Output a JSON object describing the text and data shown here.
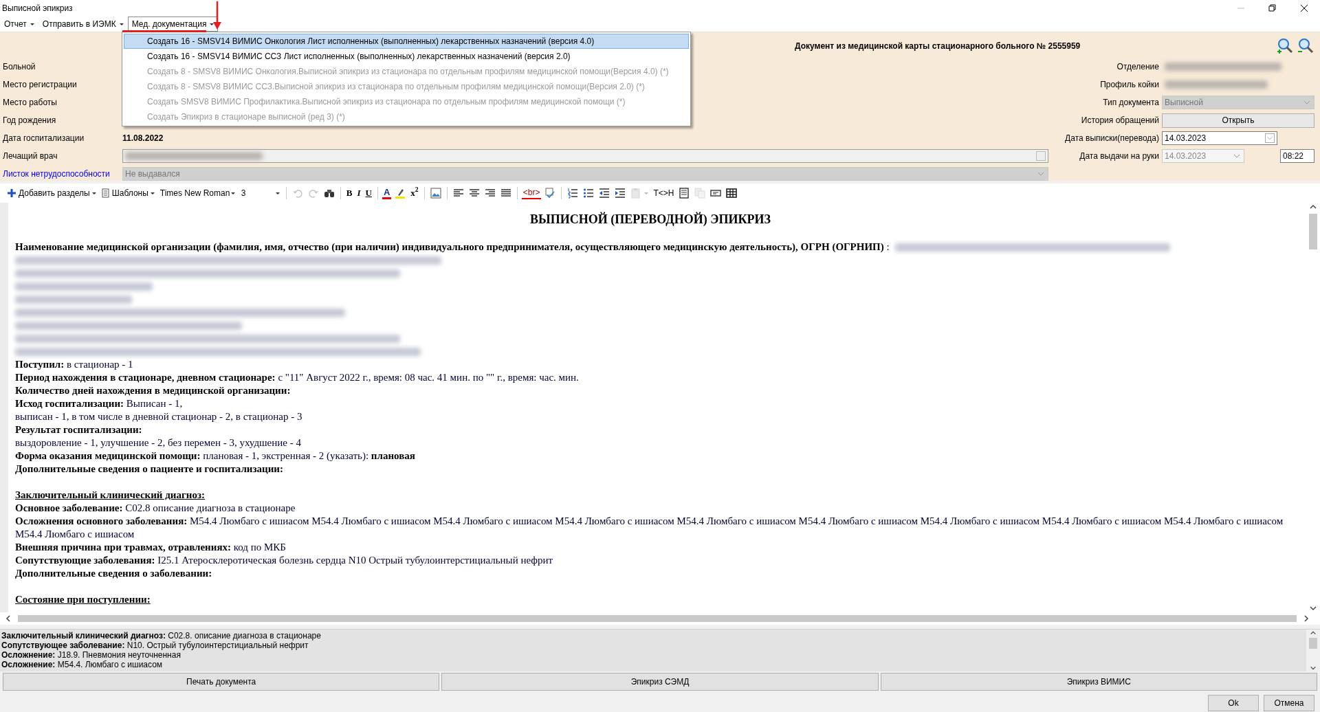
{
  "window": {
    "title": "Выписной эпикриз"
  },
  "menu": [
    {
      "label": "Отчет",
      "open": false
    },
    {
      "label": "Отправить в ИЭМК",
      "open": false
    },
    {
      "label": "Мед. документация",
      "open": true
    }
  ],
  "dropdown": [
    {
      "label": "Создать 16 - SMSV14 ВИМИС Онкология Лист исполненных (выполненных) лекарственных назначений (версия 4.0)",
      "selected": true,
      "disabled": false
    },
    {
      "label": "Создать 16 - SMSV14 ВИМИС ССЗ Лист исполненных (выполненных) лекарственных назначений (версия 2.0)",
      "selected": false,
      "disabled": false
    },
    {
      "label": "Создать 8 - SMSV8 ВИМИС Онкология.Выписной эпикриз из стационара по отдельным профилям медицинской помощи(Версия 4.0) (*)",
      "selected": false,
      "disabled": true
    },
    {
      "label": "Создать 8 - SMSV8 ВИМИС ССЗ.Выписной эпикриз из стационара по отдельным профилям медицинской помощи(Версия 2.0) (*)",
      "selected": false,
      "disabled": true
    },
    {
      "label": "Создать SMSV8 ВИМИС Профилактика.Выписной эпикриз из стационара по отдельным профилям медицинской помощи (*)",
      "selected": false,
      "disabled": true
    },
    {
      "label": "Создать Эпикриз в стационаре выписной (ред 3) (*)",
      "selected": false,
      "disabled": true
    }
  ],
  "header": {
    "title": "Документ из медицинской карты стационарного больного №  2555959",
    "left_fields": [
      {
        "label": "Больной",
        "kind": "empty",
        "link": false
      },
      {
        "label": "Место регистрации",
        "kind": "empty",
        "link": false
      },
      {
        "label": "Место работы",
        "kind": "empty",
        "link": false
      },
      {
        "label": "Год рождения",
        "kind": "empty",
        "link": false
      },
      {
        "label": "Дата госпитализации",
        "kind": "bold",
        "value": "11.08.2022",
        "link": false
      },
      {
        "label": "Лечащий врач",
        "kind": "lookup_blur",
        "link": false
      },
      {
        "label": "Листок нетрудоспособности",
        "kind": "select",
        "value": "Не выдавался",
        "disabled": true,
        "link": true
      }
    ],
    "right_fields": [
      {
        "label": "Отделение",
        "kind": "blur"
      },
      {
        "label": "Профиль койки",
        "kind": "blur"
      },
      {
        "label": "Тип документа",
        "kind": "select",
        "value": "Выписной",
        "disabled": true
      },
      {
        "label": "История обращений",
        "kind": "button",
        "value": "Открыть"
      },
      {
        "label": "Дата выписки(перевода)",
        "kind": "date",
        "value": "14.03.2023",
        "disabled": false
      },
      {
        "label": "Дата выдачи на руки",
        "kind": "date_time",
        "value": "14.03.2023",
        "time": "08:22",
        "disabled": true
      }
    ]
  },
  "toolbar": {
    "add_sections": "Добавить разделы",
    "templates": "Шаблоны",
    "font": "Times New Roman",
    "size": "3",
    "groups": [
      [
        {
          "kind": "undo",
          "disabled": true
        },
        {
          "kind": "redo",
          "disabled": true
        },
        {
          "kind": "find",
          "disabled": false
        }
      ],
      [
        {
          "kind": "bold",
          "label": "B",
          "disabled": false
        },
        {
          "kind": "italic",
          "label": "I",
          "disabled": false
        },
        {
          "kind": "underline",
          "label": "U",
          "disabled": false
        }
      ],
      [
        {
          "kind": "fontcolor",
          "label": "A",
          "disabled": false
        },
        {
          "kind": "highlight",
          "disabled": false
        },
        {
          "kind": "superscript",
          "label": "x$^{2}$",
          "disabled": false
        }
      ],
      [
        {
          "kind": "image",
          "disabled": false
        }
      ],
      [
        {
          "kind": "align-left",
          "disabled": false
        },
        {
          "kind": "align-center",
          "disabled": false
        },
        {
          "kind": "align-right",
          "disabled": false
        },
        {
          "kind": "justify",
          "disabled": false
        }
      ],
      [
        {
          "kind": "striptags",
          "label": "<br>",
          "disabled": false
        },
        {
          "kind": "spellcheck",
          "disabled": false
        }
      ],
      [
        {
          "kind": "ordered-list",
          "disabled": false
        },
        {
          "kind": "bullet-list",
          "disabled": false
        },
        {
          "kind": "outdent",
          "disabled": false
        },
        {
          "kind": "indent",
          "disabled": false
        },
        {
          "kind": "paste",
          "disabled": true
        },
        {
          "kind": "text",
          "label": "T<>H",
          "disabled": false
        },
        {
          "kind": "document",
          "disabled": false
        },
        {
          "kind": "copy",
          "disabled": true
        },
        {
          "kind": "field",
          "disabled": false
        },
        {
          "kind": "table",
          "disabled": false
        }
      ]
    ]
  },
  "document": [
    {
      "kind": "title",
      "text": "ВЫПИСНОЙ (ПЕРЕВОДНОЙ) ЭПИКРИЗ"
    },
    {
      "kind": "para_blur",
      "text": "**Наименование медицинской организации (фамилия, имя, отчество (при наличии) индивидуального предпринимателя, осуществляющего медицинскую деятельность), ОГРН (ОГРНИП)** :"
    },
    {
      "kind": "blur"
    },
    {
      "kind": "blur"
    },
    {
      "kind": "blur"
    },
    {
      "kind": "blur"
    },
    {
      "kind": "blur"
    },
    {
      "kind": "blur"
    },
    {
      "kind": "blur"
    },
    {
      "kind": "blur"
    },
    {
      "kind": "para",
      "text": "**Поступил:** в стационар - 1"
    },
    {
      "kind": "para",
      "text": "**Период нахождения в стационаре, дневном стационаре:** с \"11\" Август 2022 г., время: 08 час. 41 мин. по \"\" г., время: час. мин."
    },
    {
      "kind": "para",
      "text": "**Количество дней нахождения в медицинской организации:**"
    },
    {
      "kind": "para",
      "text": "**Исход госпитализации:** Выписан - 1,"
    },
    {
      "kind": "para",
      "text": "выписан - 1, в том числе в дневной стационар - 2, в стационар - 3"
    },
    {
      "kind": "para",
      "text": "**Результат госпитализации:**"
    },
    {
      "kind": "para",
      "text": "выздоровление - 1, улучшение - 2, без перемен - 3, ухудшение - 4"
    },
    {
      "kind": "para",
      "text": "**Форма оказания медицинской помощи:** плановая - 1, экстренная - 2 (указать): **плановая**"
    },
    {
      "kind": "para",
      "text": "**Дополнительные сведения о пациенте и госпитализации:**"
    },
    {
      "kind": "blank"
    },
    {
      "kind": "section",
      "text": "Заключительный клинический диагноз:"
    },
    {
      "kind": "para",
      "text": "**Основное заболевание:** C02.8 описание диагноза в стационаре"
    },
    {
      "kind": "para",
      "text": "**Осложнения основного заболевания:** M54.4 Люмбаго с ишиасом M54.4 Люмбаго с ишиасом M54.4 Люмбаго с ишиасом M54.4 Люмбаго с ишиасом M54.4 Люмбаго с ишиасом M54.4 Люмбаго с ишиасом M54.4 Люмбаго с ишиасом M54.4 Люмбаго с ишиасом M54.4 Люмбаго с ишиасом M54.4 Люмбаго с ишиасом"
    },
    {
      "kind": "para",
      "text": "**Внешняя причина при травмах, отравлениях:** код по МКБ"
    },
    {
      "kind": "para",
      "text": "**Сопутствующие заболевания:** I25.1 Атеросклеротическая болезнь сердца N10 Острый тубулоинтерстициальный нефрит"
    },
    {
      "kind": "para",
      "text": "**Дополнительные сведения о заболевании:**"
    },
    {
      "kind": "blank"
    },
    {
      "kind": "section",
      "text": "Состояние при поступлении:"
    }
  ],
  "summary": [
    "**Заключительный клинический диагноз:** C02.8. описание диагноза в стационаре",
    "**Сопутствующее заболевание:** N10. Острый тубулоинтерстициальный нефрит",
    "**Осложнение:** J18.9. Пневмония неуточненная",
    "**Осложнение:** M54.4. Люмбаго с ишиасом"
  ],
  "actions": [
    "Печать документа",
    "Эпикриз СЭМД",
    "Эпикриз ВИМИС"
  ],
  "dialog_buttons": [
    "Ok",
    "Отмена"
  ]
}
